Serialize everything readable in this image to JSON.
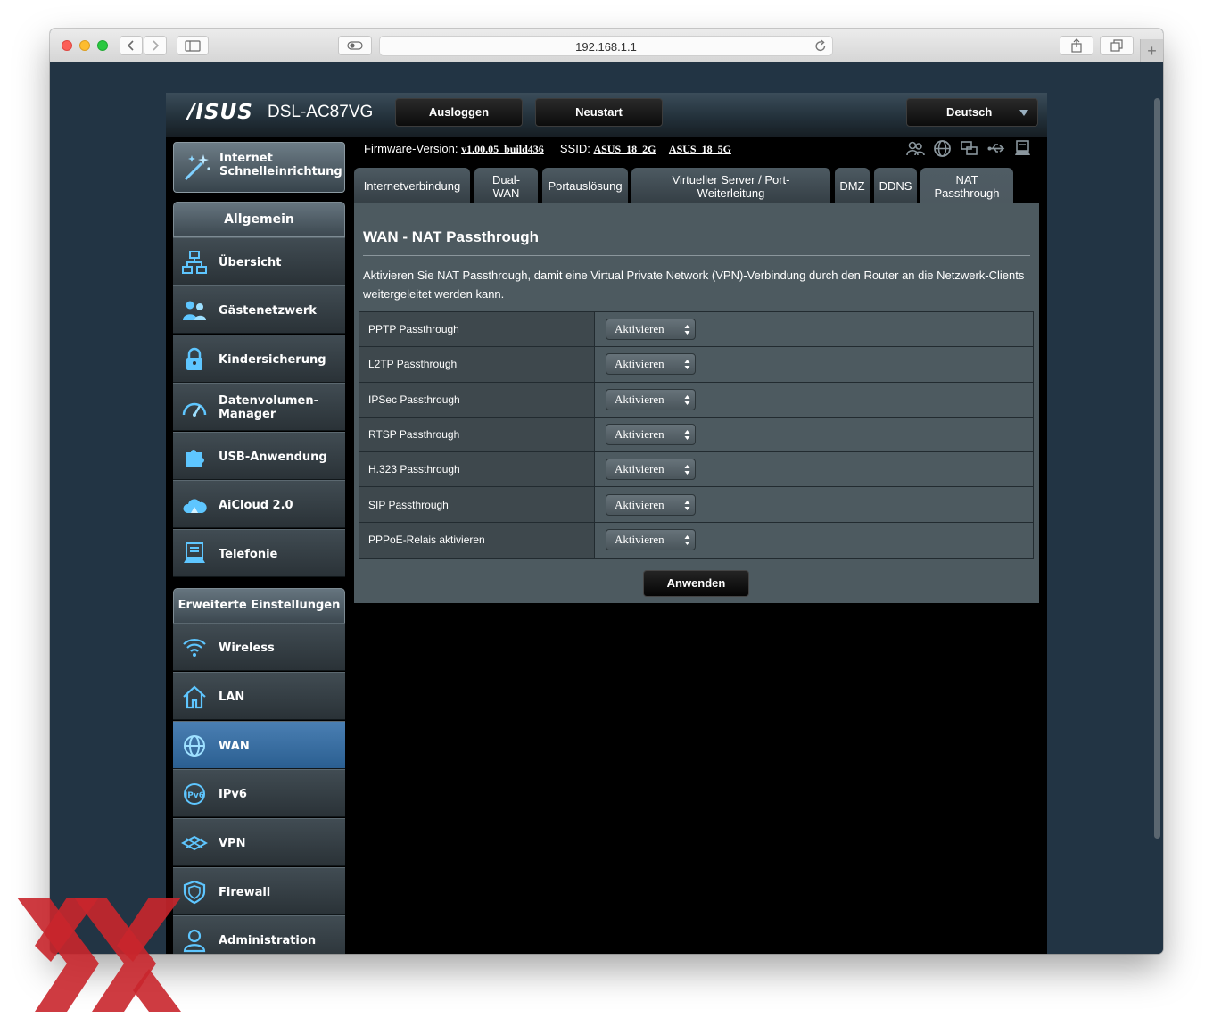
{
  "browser": {
    "url": "192.168.1.1"
  },
  "router": {
    "brand": "/ISUS",
    "model": "DSL-AC87VG",
    "buttons": {
      "logout": "Ausloggen",
      "restart": "Neustart"
    },
    "language": "Deutsch",
    "firmware_label": "Firmware-Version:",
    "firmware_version": "v1.00.05_build436",
    "ssid_label": "SSID:",
    "ssid_2g": "ASUS_18_2G",
    "ssid_5g": "ASUS_18_5G"
  },
  "sidebar": {
    "quick_setup": {
      "line1": "Internet",
      "line2": "Schnelleinrichtung",
      "icon": "wand-icon"
    },
    "general_header": "Allgemein",
    "general_items": [
      {
        "label": "Übersicht",
        "icon": "network-map-icon"
      },
      {
        "label": "Gästenetzwerk",
        "icon": "guest-network-icon"
      },
      {
        "label": "Kindersicherung",
        "icon": "parental-lock-icon"
      },
      {
        "label": "Datenvolumen-\nManager",
        "line1": "Datenvolumen-",
        "line2": "Manager",
        "icon": "gauge-icon"
      },
      {
        "label": "USB-Anwendung",
        "icon": "puzzle-icon"
      },
      {
        "label": "AiCloud 2.0",
        "icon": "cloud-icon"
      },
      {
        "label": "Telefonie",
        "icon": "phone-icon"
      }
    ],
    "advanced_header": "Erweiterte Einstellungen",
    "advanced_items": [
      {
        "label": "Wireless",
        "icon": "wifi-icon"
      },
      {
        "label": "LAN",
        "icon": "home-icon"
      },
      {
        "label": "WAN",
        "icon": "globe-icon",
        "active": true
      },
      {
        "label": "IPv6",
        "icon": "ipv6-icon"
      },
      {
        "label": "VPN",
        "icon": "vpn-icon"
      },
      {
        "label": "Firewall",
        "icon": "shield-icon"
      },
      {
        "label": "Administration",
        "icon": "admin-icon"
      }
    ]
  },
  "tabs": [
    {
      "label": "Internetverbindung"
    },
    {
      "label": "Dual-\nWAN",
      "line1": "Dual-",
      "line2": "WAN"
    },
    {
      "label": "Portauslösung"
    },
    {
      "label": "Virtueller Server / Port-\nWeiterleitung",
      "line1": "Virtueller Server / Port-",
      "line2": "Weiterleitung"
    },
    {
      "label": "DMZ"
    },
    {
      "label": "DDNS"
    },
    {
      "label": "NAT\nPassthrough",
      "line1": "NAT",
      "line2": "Passthrough",
      "active": true
    }
  ],
  "panel": {
    "title": "WAN - NAT Passthrough",
    "description": "Aktivieren Sie NAT Passthrough, damit eine Virtual Private Network (VPN)-Verbindung durch den Router an die Netzwerk-Clients weitergeleitet werden kann.",
    "rows": [
      {
        "label": "PPTP Passthrough",
        "value": "Aktivieren"
      },
      {
        "label": "L2TP Passthrough",
        "value": "Aktivieren"
      },
      {
        "label": "IPSec Passthrough",
        "value": "Aktivieren"
      },
      {
        "label": "RTSP Passthrough",
        "value": "Aktivieren"
      },
      {
        "label": "H.323 Passthrough",
        "value": "Aktivieren"
      },
      {
        "label": "SIP Passthrough",
        "value": "Aktivieren"
      },
      {
        "label": "PPPoE-Relais aktivieren",
        "value": "Aktivieren"
      }
    ],
    "apply": "Anwenden"
  },
  "colors": {
    "active_nav": "#3a6fa3",
    "panel_bg": "#4d5a60",
    "watermark": "#c9262c"
  }
}
